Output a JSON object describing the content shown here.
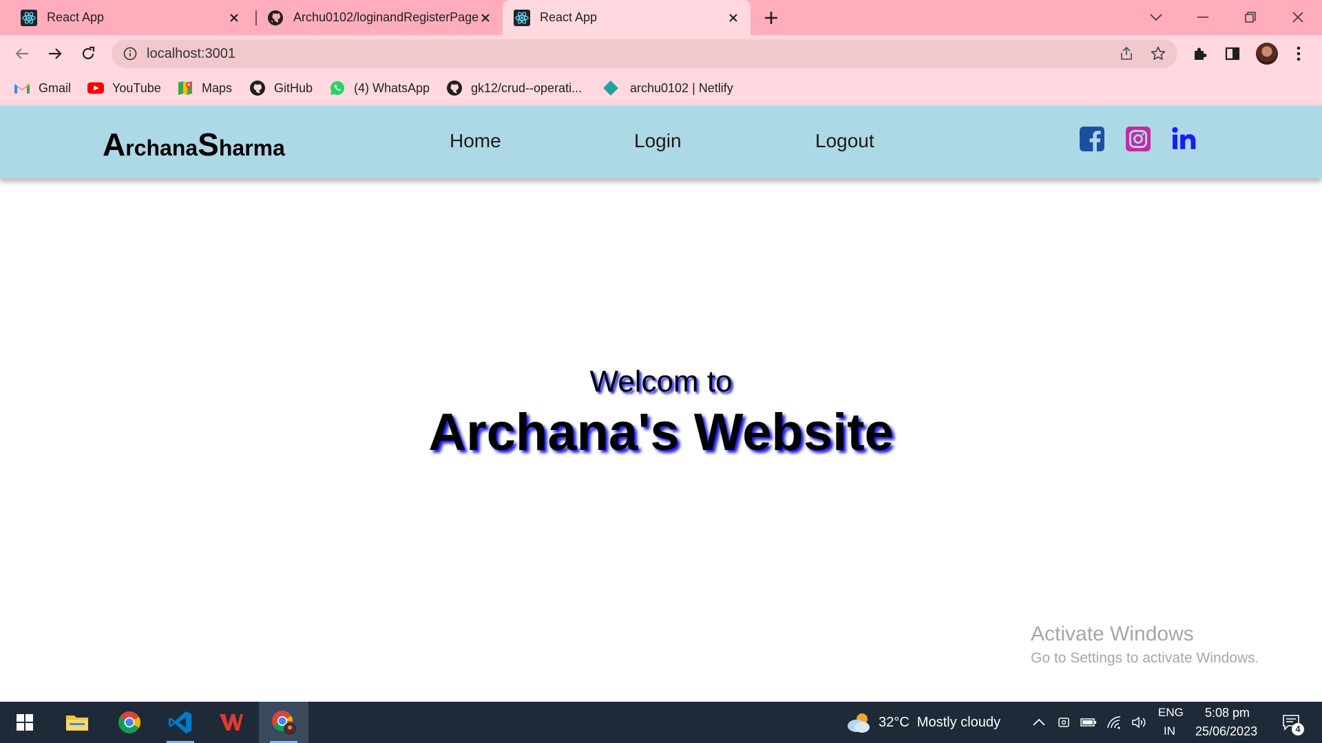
{
  "tabs": [
    {
      "title": "React App"
    },
    {
      "title": "Archu0102/loginandRegisterPage"
    },
    {
      "title": "React App"
    }
  ],
  "address_bar": {
    "url": "localhost:3001"
  },
  "bookmarks": [
    {
      "label": "Gmail"
    },
    {
      "label": "YouTube"
    },
    {
      "label": "Maps"
    },
    {
      "label": "GitHub"
    },
    {
      "label": "(4) WhatsApp"
    },
    {
      "label": "gk12/crud--operati..."
    },
    {
      "label": "archu0102 | Netlify"
    }
  ],
  "site": {
    "brand": {
      "a": "A",
      "rchana": "rchana",
      "s": "S",
      "harma": "harma"
    },
    "nav": {
      "home": "Home",
      "login": "Login",
      "logout": "Logout"
    },
    "hero": {
      "line1": "Welcom to",
      "line2": "Archana's Website"
    }
  },
  "watermark": {
    "title": "Activate Windows",
    "subtitle": "Go to Settings to activate Windows."
  },
  "taskbar": {
    "weather": "32°C  Mostly cloudy",
    "lang_top": "ENG",
    "lang_bottom": "IN",
    "time": "5:08 pm",
    "date": "25/06/2023",
    "notification_count": "4"
  },
  "colors": {
    "tab_strip": "#ffadbd",
    "toolbar": "#ffd9df",
    "site_nav": "#add8e6",
    "hero_shadow": "#1a1aff",
    "facebook": "#1a4fa0",
    "instagram": "#c32aa3",
    "linkedin": "#1a1aff"
  }
}
